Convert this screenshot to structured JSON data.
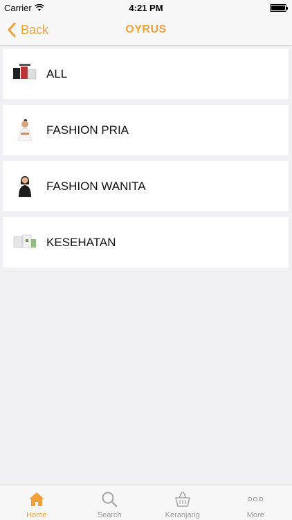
{
  "status": {
    "carrier": "Carrier",
    "time": "4:21 PM"
  },
  "nav": {
    "back_label": "Back",
    "title": "OYRUS"
  },
  "categories": [
    {
      "label": "ALL",
      "icon": "product-collage-thumbnail"
    },
    {
      "label": "FASHION PRIA",
      "icon": "man-fashion-thumbnail"
    },
    {
      "label": "FASHION WANITA",
      "icon": "woman-fashion-thumbnail"
    },
    {
      "label": "KESEHATAN",
      "icon": "health-products-thumbnail"
    }
  ],
  "tabs": [
    {
      "label": "Home",
      "icon": "home-icon",
      "active": true
    },
    {
      "label": "Search",
      "icon": "search-icon",
      "active": false
    },
    {
      "label": "Keranjang",
      "icon": "basket-icon",
      "active": false
    },
    {
      "label": "More",
      "icon": "more-icon",
      "active": false
    }
  ],
  "colors": {
    "accent": "#f2a13a",
    "inactive": "#9a9a9a",
    "background": "#efeff4"
  }
}
